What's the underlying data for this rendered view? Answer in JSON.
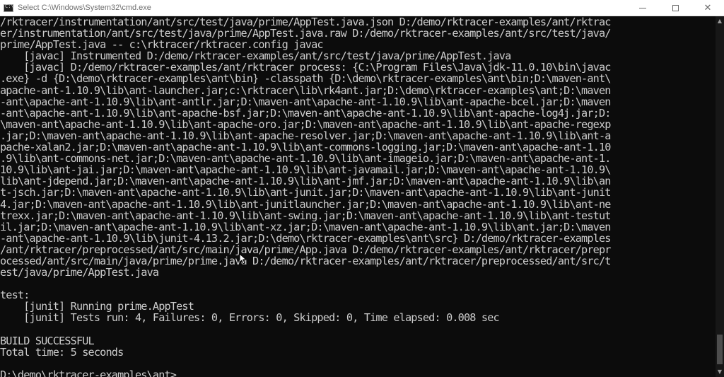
{
  "window": {
    "title": "Select C:\\Windows\\System32\\cmd.exe",
    "icon": "cmd-icon",
    "controls": {
      "minimize": "minimize-icon",
      "maximize": "maximize-icon",
      "close": "close-icon"
    }
  },
  "console": {
    "lines": [
      "/rktracer/instrumentation/ant/src/test/java/prime/AppTest.java.json D:/demo/rktracer-examples/ant/rktrac",
      "er/instrumentation/ant/src/test/java/prime/AppTest.java.raw D:/demo/rktracer-examples/ant/src/test/java/",
      "prime/AppTest.java -- c:\\rktracer/rktracer.config javac",
      "    [javac] Instrumented D:/demo/rktracer-examples/ant/src/test/java/prime/AppTest.java",
      "    [javac] D:/demo/rktracer-examples/ant/rktracer process: {C:\\Program Files\\Java\\jdk-11.0.10\\bin\\javac",
      ".exe} -d {D:\\demo\\rktracer-examples\\ant\\bin} -classpath {D:\\demo\\rktracer-examples\\ant\\bin;D:\\maven-ant\\",
      "apache-ant-1.10.9\\lib\\ant-launcher.jar;c:\\rktracer\\lib\\rk4ant.jar;D:\\demo\\rktracer-examples\\ant;D:\\maven",
      "-ant\\apache-ant-1.10.9\\lib\\ant-antlr.jar;D:\\maven-ant\\apache-ant-1.10.9\\lib\\ant-apache-bcel.jar;D:\\maven",
      "-ant\\apache-ant-1.10.9\\lib\\ant-apache-bsf.jar;D:\\maven-ant\\apache-ant-1.10.9\\lib\\ant-apache-log4j.jar;D:",
      "\\maven-ant\\apache-ant-1.10.9\\lib\\ant-apache-oro.jar;D:\\maven-ant\\apache-ant-1.10.9\\lib\\ant-apache-regexp",
      ".jar;D:\\maven-ant\\apache-ant-1.10.9\\lib\\ant-apache-resolver.jar;D:\\maven-ant\\apache-ant-1.10.9\\lib\\ant-a",
      "pache-xalan2.jar;D:\\maven-ant\\apache-ant-1.10.9\\lib\\ant-commons-logging.jar;D:\\maven-ant\\apache-ant-1.10",
      ".9\\lib\\ant-commons-net.jar;D:\\maven-ant\\apache-ant-1.10.9\\lib\\ant-imageio.jar;D:\\maven-ant\\apache-ant-1.",
      "10.9\\lib\\ant-jai.jar;D:\\maven-ant\\apache-ant-1.10.9\\lib\\ant-javamail.jar;D:\\maven-ant\\apache-ant-1.10.9\\",
      "lib\\ant-jdepend.jar;D:\\maven-ant\\apache-ant-1.10.9\\lib\\ant-jmf.jar;D:\\maven-ant\\apache-ant-1.10.9\\lib\\an",
      "t-jsch.jar;D:\\maven-ant\\apache-ant-1.10.9\\lib\\ant-junit.jar;D:\\maven-ant\\apache-ant-1.10.9\\lib\\ant-junit",
      "4.jar;D:\\maven-ant\\apache-ant-1.10.9\\lib\\ant-junitlauncher.jar;D:\\maven-ant\\apache-ant-1.10.9\\lib\\ant-ne",
      "trexx.jar;D:\\maven-ant\\apache-ant-1.10.9\\lib\\ant-swing.jar;D:\\maven-ant\\apache-ant-1.10.9\\lib\\ant-testut",
      "il.jar;D:\\maven-ant\\apache-ant-1.10.9\\lib\\ant-xz.jar;D:\\maven-ant\\apache-ant-1.10.9\\lib\\ant.jar;D:\\maven",
      "-ant\\apache-ant-1.10.9\\lib\\junit-4.13.2.jar;D:\\demo\\rktracer-examples\\ant\\src} D:/demo/rktracer-examples",
      "/ant/rktracer/preprocessed/ant/src/main/java/prime/App.java D:/demo/rktracer-examples/ant/rktracer/prepr",
      "ocessed/ant/src/main/java/prime/prime.java D:/demo/rktracer-examples/ant/rktracer/preprocessed/ant/src/t",
      "est/java/prime/AppTest.java",
      "",
      "test:",
      "    [junit] Running prime.AppTest",
      "    [junit] Tests run: 4, Failures: 0, Errors: 0, Skipped: 0, Time elapsed: 0.008 sec",
      "",
      "BUILD SUCCESSFUL",
      "Total time: 5 seconds",
      "",
      "D:\\demo\\rktracer-examples\\ant>"
    ]
  },
  "colors": {
    "console_background": "#0c0c0c",
    "console_text": "#cccccc",
    "titlebar_background": "#ffffff",
    "titlebar_text": "#6e6e6e"
  }
}
